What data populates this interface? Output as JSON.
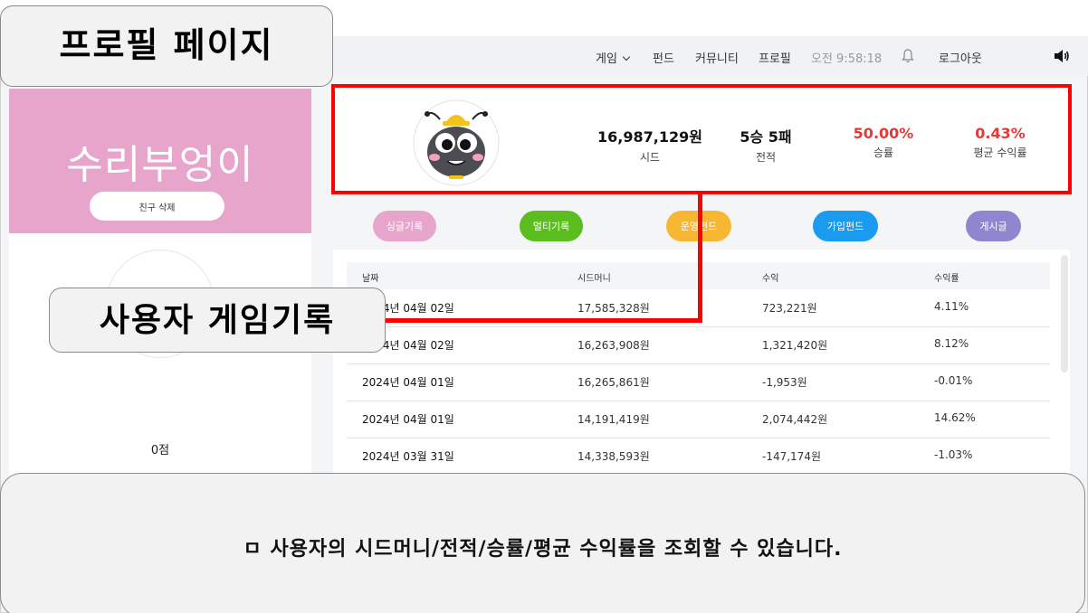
{
  "slide": {
    "title": "프로필 페이지",
    "game_record_label": "사용자 게임기록",
    "description": "ㅁ 사용자의 시드머니/전적/승률/평균 수익률을 조회할 수 있습니다."
  },
  "navbar": {
    "game": "게임",
    "fund": "펀드",
    "community": "커뮤니티",
    "profile": "프로필",
    "time": "오전 9:58:18",
    "logout": "로그아웃"
  },
  "sidebar": {
    "nickname": "수리부엉이",
    "friend_delete_label": "친구 삭제",
    "score": "0점"
  },
  "stats": {
    "seed": {
      "value": "16,987,129원",
      "label": "시드"
    },
    "record": {
      "value": "5승 5패",
      "label": "전적"
    },
    "winrate": {
      "value": "50.00%",
      "label": "승률"
    },
    "avg_return": {
      "value": "0.43%",
      "label": "평균 수익률"
    }
  },
  "tabs": [
    {
      "label": "싱글기록",
      "color": "#e7a5cb"
    },
    {
      "label": "멀티기록",
      "color": "#5cbd1f"
    },
    {
      "label": "운영펀드",
      "color": "#f7b733"
    },
    {
      "label": "가입펀드",
      "color": "#1a9bf0"
    },
    {
      "label": "게시글",
      "color": "#8f86cf"
    }
  ],
  "table": {
    "headers": [
      "날짜",
      "시드머니",
      "수익",
      "수익률"
    ],
    "rows": [
      {
        "date": "2024년 04월 02일",
        "seed": "17,585,328원",
        "profit": "723,221원",
        "rate": "4.11%"
      },
      {
        "date": "2024년 04월 02일",
        "seed": "16,263,908원",
        "profit": "1,321,420원",
        "rate": "8.12%"
      },
      {
        "date": "2024년 04월 01일",
        "seed": "16,265,861원",
        "profit": "-1,953원",
        "rate": "-0.01%"
      },
      {
        "date": "2024년 04월 01일",
        "seed": "14,191,419원",
        "profit": "2,074,442원",
        "rate": "14.62%"
      },
      {
        "date": "2024년 03월 31일",
        "seed": "14,338,593원",
        "profit": "-147,174원",
        "rate": "-1.03%"
      }
    ]
  },
  "icons": {
    "bell": "bell-icon",
    "speaker": "speaker-icon",
    "avatar": "bug-character-avatar"
  },
  "colors": {
    "highlight": "#ff0000",
    "profile_card": "#e7a5cb",
    "stat_red": "#e53935"
  }
}
